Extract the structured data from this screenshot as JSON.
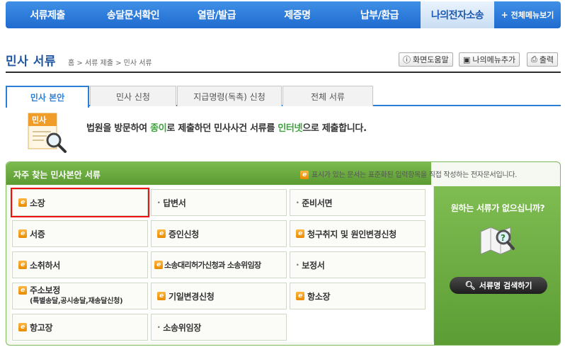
{
  "topnav": {
    "items": [
      {
        "label": "서류제출"
      },
      {
        "label": "송달문서확인"
      },
      {
        "label": "열람/발급"
      },
      {
        "label": "제증명"
      },
      {
        "label": "납부/환급"
      },
      {
        "label": "나의전자소송"
      }
    ],
    "all_menu": "전체메뉴보기"
  },
  "header": {
    "title": "민사 서류",
    "breadcrumb": "홈 > 서류 제출 > 민사 서류",
    "help": "화면도움말",
    "add_menu": "나의메뉴추가",
    "print": "출력"
  },
  "tabs": [
    {
      "label": "민사 본안"
    },
    {
      "label": "민사 신청"
    },
    {
      "label": "지급명령(독촉) 신청"
    },
    {
      "label": "전체 서류"
    }
  ],
  "intro": {
    "icon_label": "민사",
    "text_a": "법원을 방문하여 ",
    "text_b": "종이",
    "text_c": "로 제출하던 민사사건 서류를 ",
    "text_d": "인터넷",
    "text_e": "으로 제출합니다."
  },
  "panel": {
    "title": "자주 찾는 민사본안 서류",
    "note": "표시가 있는 문서는 표준화된 입력항목을 직접 작성하는 전자문서입니다.",
    "cells": [
      {
        "label": "소장",
        "type": "e"
      },
      {
        "label": "답변서",
        "type": "dot"
      },
      {
        "label": "준비서면",
        "type": "dot"
      },
      {
        "label": "서증",
        "type": "e"
      },
      {
        "label": "증인신청",
        "type": "e"
      },
      {
        "label": "청구취지 및 원인변경신청",
        "type": "e"
      },
      {
        "label": "소취하서",
        "type": "e"
      },
      {
        "label": "소송대리허가신청과 소송위임장",
        "type": "e"
      },
      {
        "label": "보정서",
        "type": "dot"
      },
      {
        "label": "주소보정",
        "sub": "(특별송달,공시송달,재송달신청)",
        "type": "e"
      },
      {
        "label": "기일변경신청",
        "type": "e"
      },
      {
        "label": "항소장",
        "type": "e"
      },
      {
        "label": "항고장",
        "type": "e"
      },
      {
        "label": "소송위임장",
        "type": "dot"
      }
    ]
  },
  "side": {
    "question": "원하는 서류가 없으십니까?",
    "search_button": "서류명 검색하기"
  }
}
